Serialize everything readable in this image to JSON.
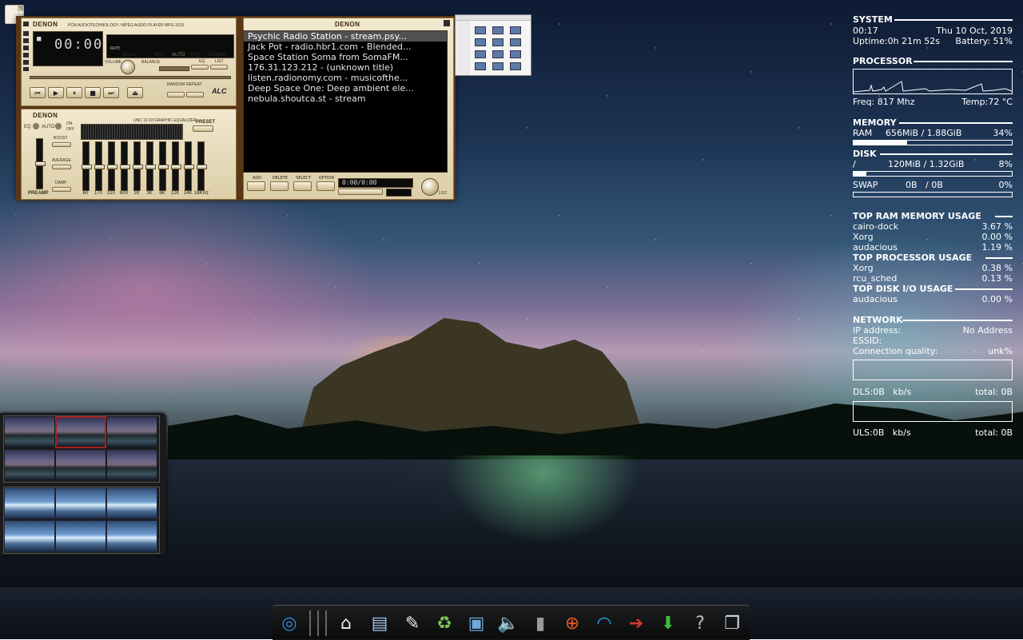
{
  "player": {
    "brand": "DENON",
    "model_caption": "PCM AUDIOTECHNOLOGY / MPEG AUDIO PLAYER  MPG-1515",
    "time_display": "00:00",
    "kbps_label": "kbps",
    "khz_label": "kHz",
    "auto_label": "AUTO",
    "output_label": "Output",
    "volume_label": "VOLUME",
    "balance_label": "BALANCE",
    "eq_label": "EQ",
    "list_label": "LIST",
    "random_label": "RANDOM",
    "repeat_label": "REPEAT",
    "rate_label": "RATE",
    "logo_caption": "ALC",
    "eq_panel": {
      "brand": "DENON",
      "eq_label": "EQ",
      "auto_label": "AUTO",
      "on_label": "ON",
      "off_label": "OFF",
      "caption": "UNC 16 03 GRAPHIC EQUALIZER",
      "preset_label": "PRESET",
      "boost_label": "BOOST",
      "average_label": "AVERAGE",
      "damp_label": "DAMP",
      "preamp_label": "PREAMP",
      "bands": [
        "60",
        "170",
        "310",
        "600",
        "1K",
        "3K",
        "6K",
        "12K",
        "14K",
        "16KHz"
      ],
      "band_levels": [
        0.5,
        0.5,
        0.5,
        0.5,
        0.5,
        0.5,
        0.5,
        0.5,
        0.5,
        0.5
      ],
      "preamp_level": 0.5
    },
    "playlist_panel": {
      "brand": "DENON",
      "items": [
        "Psychic Radio Station - stream.psy...",
        "Jack Pot - radio.hbr1.com - Blended...",
        "Space Station Soma from SomaFM...",
        "176.31.123.212 - (unknown title)",
        "listen.radionomy.com - musicofthe...",
        "Deep Space One: Deep ambient ele...",
        "nebula.shoutca.st - stream"
      ],
      "selected_index": 0,
      "buttons": [
        "ADD",
        "DELETE",
        "SELECT",
        "OPTION"
      ],
      "time": "0:00/0:00",
      "list_label": "LIST"
    }
  },
  "conky": {
    "system": {
      "heading": "SYSTEM",
      "time": "00:17",
      "date": "Thu 10 Oct, 2019",
      "uptime": "Uptime:0h 21m 52s",
      "battery": "Battery: 51%"
    },
    "processor": {
      "heading": "PROCESSOR",
      "freq": "Freq: 817 Mhz",
      "temp": "Temp:72 °C"
    },
    "memory": {
      "heading": "MEMORY",
      "label": "RAM",
      "value": "656MiB / 1.88GiB",
      "percent": "34%",
      "fraction": 0.34
    },
    "disk": {
      "heading": "DISK",
      "mount": "/",
      "value": "120MiB / 1.32GiB",
      "percent": "8%",
      "fraction": 0.08,
      "swap_label": "SWAP",
      "swap_value": "0B   / 0B",
      "swap_percent": "0%",
      "swap_fraction": 0
    },
    "top_ram": {
      "heading": "TOP RAM MEMORY USAGE",
      "rows": [
        {
          "name": "cairo-dock",
          "value": "3.67 %"
        },
        {
          "name": "Xorg",
          "value": "0.00 %"
        },
        {
          "name": "audacious",
          "value": "1.19 %"
        }
      ]
    },
    "top_cpu": {
      "heading": "TOP PROCESSOR USAGE",
      "rows": [
        {
          "name": "Xorg",
          "value": "0.38 %"
        },
        {
          "name": "rcu_sched",
          "value": "0.13 %"
        }
      ]
    },
    "top_disk": {
      "heading": "TOP DISK I/O USAGE",
      "rows": [
        {
          "name": "audacious",
          "value": "0.00 %"
        }
      ]
    },
    "network": {
      "heading": "NETWORK",
      "ip_label": "IP address:",
      "ip_value": "No Address",
      "essid_label": "ESSID:",
      "quality_label": "Connection quality:",
      "quality_value": "unk%",
      "dls": "DLS:0B   kb/s",
      "dls_total": "total: 0B",
      "uls": "ULS:0B   kb/s",
      "uls_total": "total: 0B"
    }
  },
  "dock": {
    "items": [
      {
        "name": "launcher-icon",
        "glyph": "◎",
        "color": "#2a8de0"
      },
      {
        "name": "home-folder-icon",
        "glyph": "⌂",
        "color": "#f2f2f2"
      },
      {
        "name": "file-manager-icon",
        "glyph": "▤",
        "color": "#9ec6e8"
      },
      {
        "name": "text-editor-icon",
        "glyph": "✎",
        "color": "#e8e8e8"
      },
      {
        "name": "trash-icon",
        "glyph": "♻",
        "color": "#7ec850"
      },
      {
        "name": "image-viewer-icon",
        "glyph": "▣",
        "color": "#6fa8dc"
      },
      {
        "name": "volume-icon",
        "glyph": "🔈",
        "color": "#cfcfcf"
      },
      {
        "name": "battery-icon",
        "glyph": "▮",
        "color": "#9a9a9a"
      },
      {
        "name": "help-lifebuoy-icon",
        "glyph": "⊕",
        "color": "#e85a2a"
      },
      {
        "name": "wifi-icon",
        "glyph": "◠",
        "color": "#1fa8e8"
      },
      {
        "name": "logout-icon",
        "glyph": "➔",
        "color": "#d83a2a"
      },
      {
        "name": "download-icon",
        "glyph": "⬇",
        "color": "#3cba3c"
      },
      {
        "name": "unknown-app-icon",
        "glyph": "?",
        "color": "#bdbdbd"
      },
      {
        "name": "documents-icon",
        "glyph": "❐",
        "color": "#cfe0f0"
      }
    ]
  }
}
